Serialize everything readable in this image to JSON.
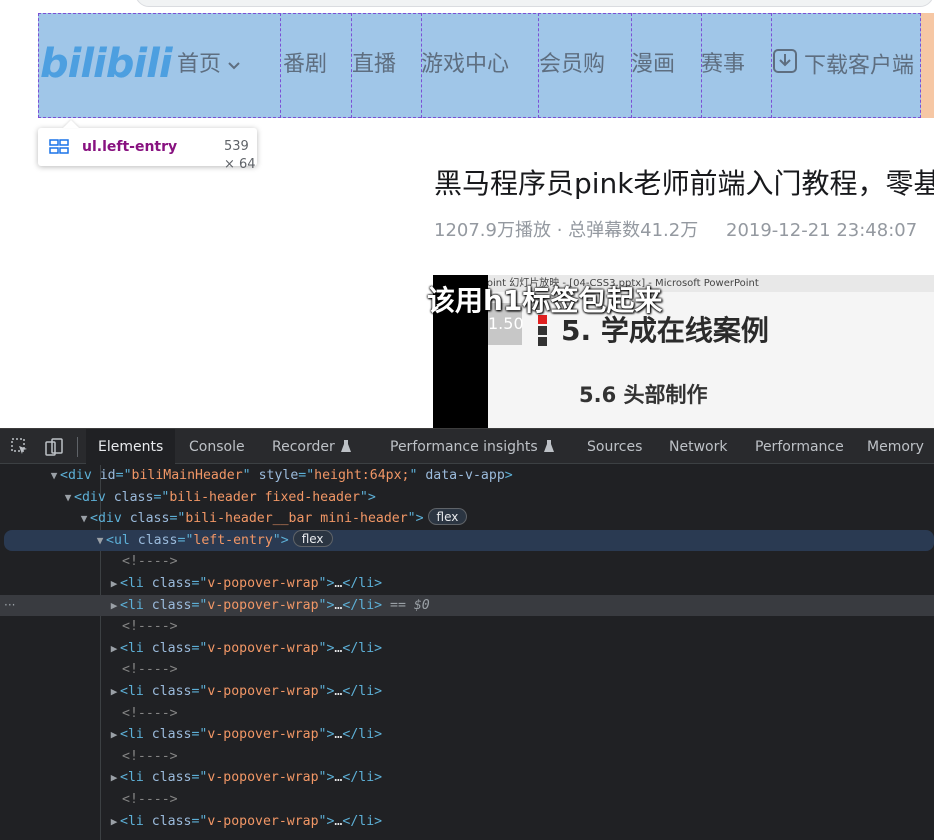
{
  "nav": {
    "logo": "bilibili",
    "items": [
      "首页",
      "番剧",
      "直播",
      "游戏中心",
      "会员购",
      "漫画",
      "赛事",
      "下载客户端"
    ]
  },
  "tooltip": {
    "selector": "ul.left-entry",
    "size": "539 × 64"
  },
  "video": {
    "title": "黑马程序员pink老师前端入门教程，零基",
    "meta": "1207.9万播放 · 总弹幕数41.2万",
    "date": "2019-12-21 23:48:07"
  },
  "player": {
    "ppt_bar": "PowerPoint 幻灯片放映 - [04-CSS3.pptx] - Microsoft PowerPoint",
    "slide_number": "1.50",
    "slide_heading": "5. 学成在线案例",
    "slide_sub": "5.6 头部制作",
    "subtitle": "该用h1标签包起来"
  },
  "devtools": {
    "tabs": [
      "Elements",
      "Console",
      "Recorder",
      "Performance insights",
      "Sources",
      "Network",
      "Performance",
      "Memory"
    ],
    "active_tab": "Elements",
    "dom": {
      "main_header": {
        "tag": "div",
        "id": "biliMainHeader",
        "style": "height:64px;",
        "extra": "data-v-app"
      },
      "header": {
        "tag": "div",
        "class": "bili-header fixed-header"
      },
      "bar": {
        "tag": "div",
        "class": "bili-header__bar mini-header",
        "badge": "flex"
      },
      "ul": {
        "tag": "ul",
        "class": "left-entry",
        "badge": "flex"
      },
      "comment": "<!---->",
      "li_class": "v-popover-wrap",
      "ellipsis": "…",
      "selected_marker": "== $0"
    }
  },
  "colors": {
    "highlight": "#6fa8dc",
    "tag": "#5db0d7",
    "attr_value": "#f29766",
    "bili_blue": "#4d9fe0"
  }
}
